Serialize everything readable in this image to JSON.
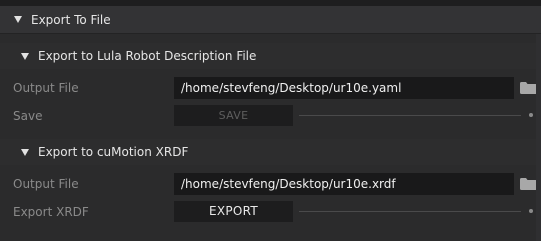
{
  "export_section": {
    "title": "Export To File"
  },
  "lula": {
    "title": "Export to Lula Robot Description File",
    "output_label": "Output File",
    "output_value": "/home/stevfeng/Desktop/ur10e.yaml",
    "save_label": "Save",
    "save_button": "SAVE"
  },
  "cumotion": {
    "title": "Export to cuMotion XRDF",
    "output_label": "Output File",
    "output_value": "/home/stevfeng/Desktop/ur10e.xrdf",
    "export_label": "Export XRDF",
    "export_button": "EXPORT"
  },
  "icons": {
    "collapse": "triangle-down-icon",
    "folder": "folder-icon"
  },
  "colors": {
    "background": "#2b2b2c",
    "field_background": "#19191a",
    "header_text": "#e6e6e6",
    "label_text": "#8a8a8a"
  }
}
